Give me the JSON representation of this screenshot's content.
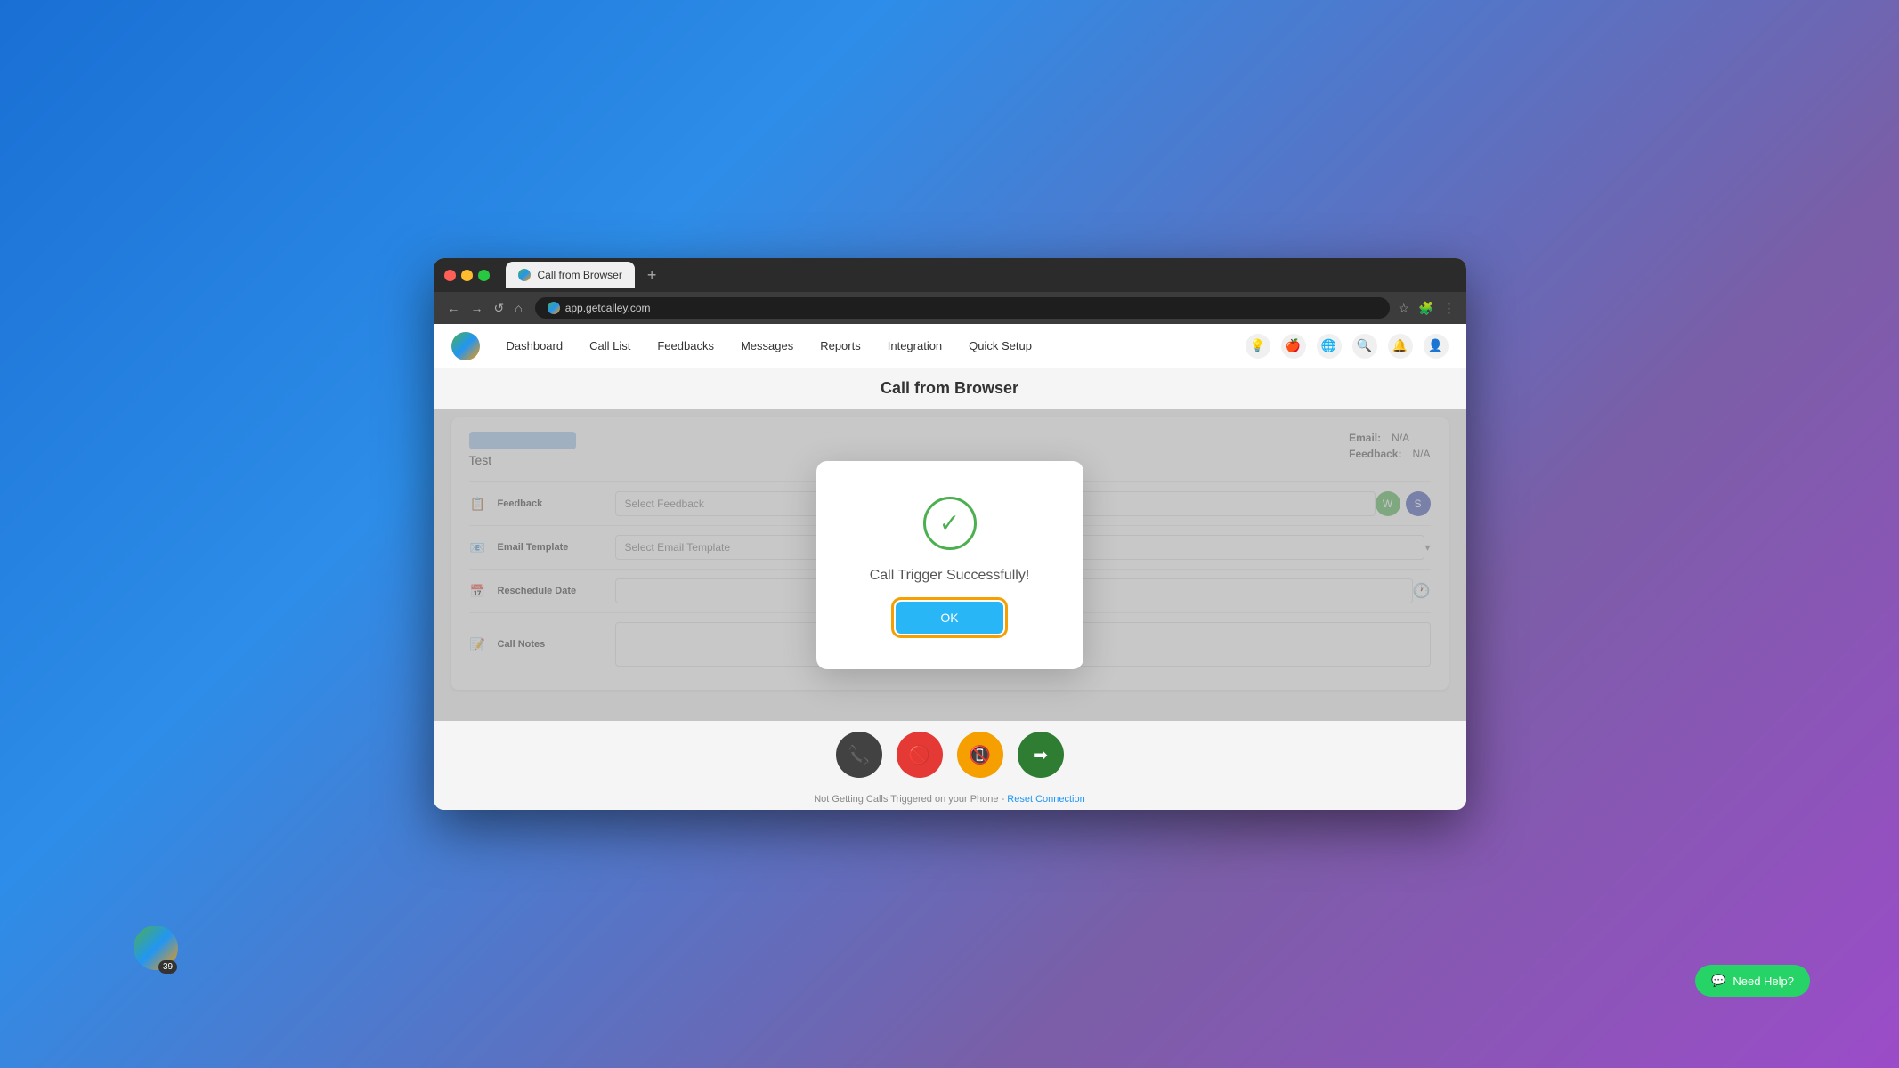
{
  "browser": {
    "tab_title": "Call from Browser",
    "tab_new_label": "+",
    "address": "app.getcalley.com"
  },
  "nav": {
    "back_label": "←",
    "forward_label": "→",
    "reload_label": "↺",
    "home_label": "⌂",
    "dashboard_label": "Dashboard",
    "calllist_label": "Call List",
    "feedbacks_label": "Feedbacks",
    "messages_label": "Messages",
    "reports_label": "Reports",
    "integration_label": "Integration",
    "quicksetup_label": "Quick Setup"
  },
  "page": {
    "title": "Call from Browser"
  },
  "contact": {
    "name": "Test",
    "email_label": "Email:",
    "email_value": "N/A",
    "feedback_label": "Feedback:",
    "feedback_value": "N/A"
  },
  "form": {
    "feedback_section_label": "Feedback",
    "feedback_placeholder": "Select Feedback",
    "email_template_section_label": "Email Template",
    "email_template_placeholder": "Select Email Template",
    "reschedule_label": "Reschedule Date",
    "call_notes_label": "Call Notes"
  },
  "modal": {
    "success_icon": "✓",
    "message": "Call Trigger Successfully!",
    "ok_label": "OK"
  },
  "footer": {
    "message": "Not Getting Calls Triggered on your Phone - Reset Connection",
    "link_text": "Reset Connection"
  },
  "bottom_logo": {
    "badge": "39"
  },
  "need_help": {
    "label": "Need Help?"
  },
  "colors": {
    "success": "#4CAF50",
    "primary": "#29b6f6",
    "accent": "#f59f00",
    "red": "#e53935",
    "dark": "#424242",
    "green_dark": "#2e7d32",
    "whatsapp": "#25d366"
  }
}
